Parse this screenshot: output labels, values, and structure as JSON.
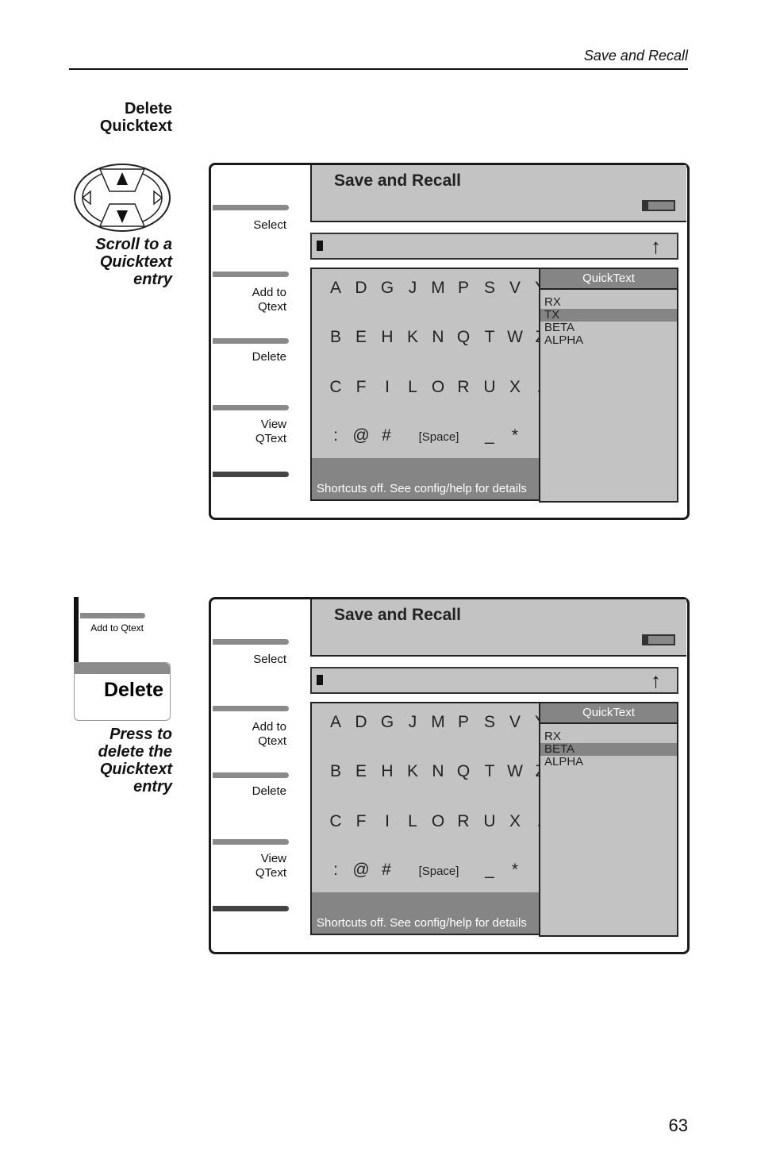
{
  "header": {
    "section_title": "Save and Recall"
  },
  "page_number": "63",
  "steps": [
    {
      "title": "Delete Quicktext",
      "icon": "directional-pad-up-down",
      "caption": "Scroll to a Quicktext entry"
    },
    {
      "icon": "delete-softkey",
      "caption": "Press to delete the Quicktext entry",
      "mini_label": "Add to Qtext",
      "mini_key": "Delete"
    }
  ],
  "screens": [
    {
      "title": "Save and Recall",
      "softkeys": [
        "Select",
        "Add to\nQtext",
        "Delete",
        "View\nQText"
      ],
      "keyboard": [
        [
          "A",
          "D",
          "G",
          "J",
          "M",
          "P",
          "S",
          "V",
          "Y"
        ],
        [
          "B",
          "E",
          "H",
          "K",
          "N",
          "Q",
          "T",
          "W",
          "Z"
        ],
        [
          "C",
          "F",
          "I",
          "L",
          "O",
          "R",
          "U",
          "X",
          "/"
        ],
        [
          ":",
          "@",
          "#",
          "[Space]",
          "_",
          "*",
          "("
        ]
      ],
      "status": "Shortcuts off. See config/help for details",
      "quicktext": {
        "header": "QuickText",
        "items": [
          "RX",
          "TX",
          "BETA",
          "ALPHA"
        ],
        "selected": "TX"
      }
    },
    {
      "title": "Save and Recall",
      "softkeys": [
        "Select",
        "Add to\nQtext",
        "Delete",
        "View\nQText"
      ],
      "keyboard": [
        [
          "A",
          "D",
          "G",
          "J",
          "M",
          "P",
          "S",
          "V",
          "Y"
        ],
        [
          "B",
          "E",
          "H",
          "K",
          "N",
          "Q",
          "T",
          "W",
          "Z"
        ],
        [
          "C",
          "F",
          "I",
          "L",
          "O",
          "R",
          "U",
          "X",
          "/"
        ],
        [
          ":",
          "@",
          "#",
          "[Space]",
          "_",
          "*",
          "("
        ]
      ],
      "status": "Shortcuts off. See config/help for details",
      "quicktext": {
        "header": "QuickText",
        "items": [
          "RX",
          "BETA",
          "ALPHA"
        ],
        "selected": "BETA"
      }
    }
  ],
  "colors": {
    "screen_gray": "#c3c3c3",
    "dark_gray": "#858585",
    "selection": "#858585"
  }
}
